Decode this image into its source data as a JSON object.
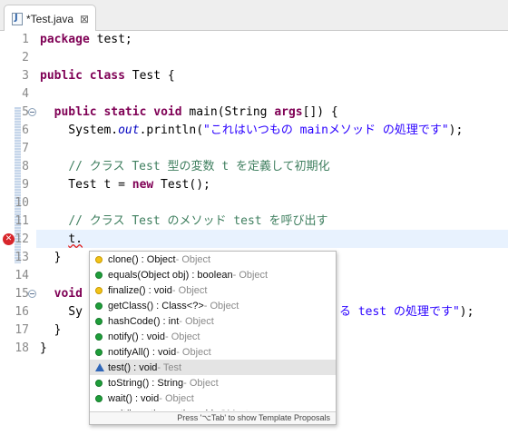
{
  "tab": {
    "label": "*Test.java",
    "icon": "java-file-icon",
    "close_icon": "close-icon"
  },
  "editor": {
    "lines": [
      {
        "num": "1",
        "parts": [
          [
            "kw",
            "package"
          ],
          [
            "",
            "test;"
          ]
        ]
      },
      {
        "num": "2",
        "parts": []
      },
      {
        "num": "3",
        "parts": [
          [
            "kw",
            "public"
          ],
          [
            "",
            " "
          ],
          [
            "kw",
            "class"
          ],
          [
            "",
            " Test {"
          ]
        ]
      },
      {
        "num": "4",
        "parts": []
      },
      {
        "num": "5",
        "parts": [
          [
            "",
            "  "
          ],
          [
            "kw",
            "public"
          ],
          [
            "",
            " "
          ],
          [
            "kw",
            "static"
          ],
          [
            "",
            " "
          ],
          [
            "kw",
            "void"
          ],
          [
            "",
            " main(String "
          ],
          [
            "kw",
            "args"
          ],
          [
            "",
            "[]) {"
          ]
        ]
      },
      {
        "num": "6",
        "parts": [
          [
            "",
            "    System."
          ],
          [
            "fld",
            "out"
          ],
          [
            "",
            ".println("
          ],
          [
            "str",
            "\"これはいつもの mainメソッド の処理です\""
          ],
          [
            "",
            ");"
          ]
        ]
      },
      {
        "num": "7",
        "parts": []
      },
      {
        "num": "8",
        "parts": [
          [
            "",
            "    "
          ],
          [
            "cmt",
            "// クラス Test 型の変数 t を定義して初期化"
          ]
        ]
      },
      {
        "num": "9",
        "parts": [
          [
            "",
            "    Test t = "
          ],
          [
            "kw",
            "new"
          ],
          [
            "",
            " Test();"
          ]
        ]
      },
      {
        "num": "10",
        "parts": []
      },
      {
        "num": "11",
        "parts": [
          [
            "",
            "    "
          ],
          [
            "cmt",
            "// クラス Test のメソッド test を呼び出す"
          ]
        ]
      },
      {
        "num": "12",
        "parts": [
          [
            "",
            "    "
          ],
          [
            "err",
            "t."
          ]
        ]
      },
      {
        "num": "13",
        "parts": [
          [
            "",
            "  }"
          ]
        ]
      },
      {
        "num": "14",
        "parts": []
      },
      {
        "num": "15",
        "parts": [
          [
            "",
            "  "
          ],
          [
            "kw",
            "void"
          ],
          [
            "",
            " t"
          ]
        ]
      },
      {
        "num": "16",
        "parts": [
          [
            "",
            "    Sy"
          ]
        ]
      },
      {
        "num": "17",
        "parts": [
          [
            "",
            "  }"
          ]
        ]
      },
      {
        "num": "18",
        "parts": [
          [
            "",
            "}"
          ]
        ]
      }
    ],
    "line16_tail": [
      [
        "str",
        "る test の処理です\""
      ],
      [
        "",
        ");"
      ]
    ],
    "error_marker_line": "12",
    "error_icon": "error-icon"
  },
  "completion": {
    "items": [
      {
        "name": "clone() : Object",
        "owner": " - Object",
        "visibility": "protected"
      },
      {
        "name": "equals(Object obj) : boolean",
        "owner": " - Object",
        "visibility": "public"
      },
      {
        "name": "finalize() : void",
        "owner": " - Object",
        "visibility": "protected"
      },
      {
        "name": "getClass() : Class<?>",
        "owner": " - Object",
        "visibility": "public"
      },
      {
        "name": "hashCode() : int",
        "owner": " - Object",
        "visibility": "public"
      },
      {
        "name": "notify() : void",
        "owner": " - Object",
        "visibility": "public"
      },
      {
        "name": "notifyAll() : void",
        "owner": " - Object",
        "visibility": "public"
      },
      {
        "name": "test() : void",
        "owner": " - Test",
        "visibility": "default",
        "selected": true
      },
      {
        "name": "toString() : String",
        "owner": " - Object",
        "visibility": "public"
      },
      {
        "name": "wait() : void",
        "owner": " - Object",
        "visibility": "public"
      },
      {
        "name": "wait(long timeout) : void",
        "owner": " - Object",
        "visibility": "public"
      }
    ],
    "footer": "Press '⌥Tab' to show Template Proposals"
  }
}
